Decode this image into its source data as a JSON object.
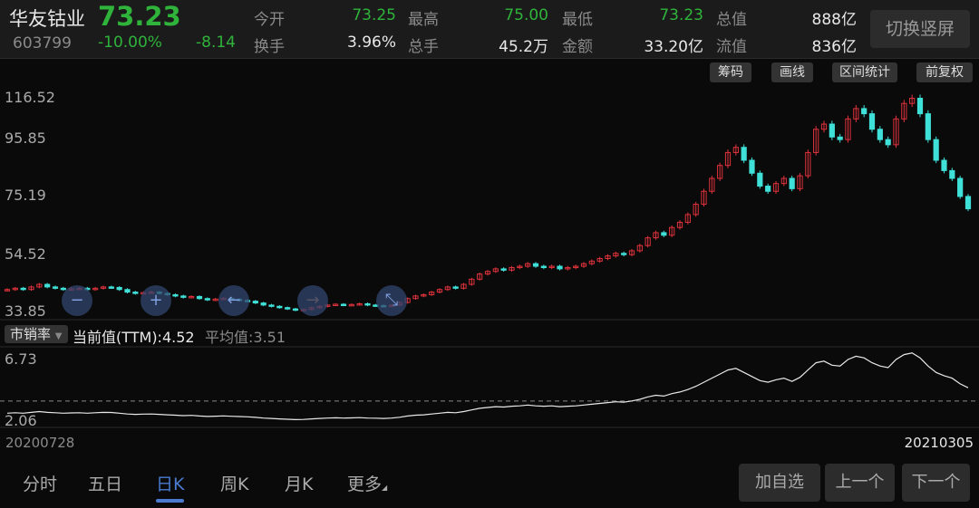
{
  "stock": {
    "name": "华友钴业",
    "code": "603799",
    "price": "73.23",
    "pct": "-10.00%",
    "change": "-8.14"
  },
  "stats": [
    {
      "label": "今开",
      "value": "73.25",
      "color": "g"
    },
    {
      "label": "最高",
      "value": "75.00",
      "color": "g"
    },
    {
      "label": "最低",
      "value": "73.23",
      "color": "g"
    },
    {
      "label": "总值",
      "value": "888亿",
      "color": "w"
    },
    {
      "label": "换手",
      "value": "3.96%",
      "color": "w"
    },
    {
      "label": "总手",
      "value": "45.2万",
      "color": "w"
    },
    {
      "label": "金额",
      "value": "33.20亿",
      "color": "w"
    },
    {
      "label": "流值",
      "value": "836亿",
      "color": "w"
    }
  ],
  "switch_label": "切换竖屏",
  "toolbar": [
    "筹码",
    "画线",
    "区间统计",
    "前复权"
  ],
  "indicator": {
    "name": "市销率",
    "current": "当前值(TTM):4.52",
    "average": "平均值:3.51"
  },
  "tabs": [
    "分时",
    "五日",
    "日K",
    "周K",
    "月K",
    "更多"
  ],
  "active_tab": 2,
  "actions": [
    "加自选",
    "上一个",
    "下一个"
  ],
  "colors": {
    "up": "#e0323c",
    "down": "#3fe0d8",
    "accent": "#4a7bd0"
  },
  "chart_data": {
    "type": "candlestick",
    "price_ticks": [
      "116.52",
      "95.85",
      "75.19",
      "54.52",
      "33.85"
    ],
    "price_range": [
      33.85,
      116.52
    ],
    "ps_ticks": [
      "6.73",
      "2.06"
    ],
    "ps_range": [
      2.06,
      6.73
    ],
    "ps_average": 3.51,
    "ps_per_price": 0.0617,
    "start_date": "20200728",
    "end_date": "20210305",
    "closes": [
      42,
      42.5,
      42,
      43,
      44,
      43,
      42.5,
      42,
      42.3,
      42.5,
      42,
      42.5,
      43,
      42.8,
      42,
      41,
      40.5,
      40.8,
      41,
      40.5,
      40,
      39.5,
      39,
      39.3,
      38.5,
      38,
      38.3,
      38.6,
      38.2,
      37.8,
      37.5,
      36.8,
      36,
      35.5,
      35,
      34.5,
      34,
      34.3,
      35,
      35.5,
      36,
      36.3,
      36,
      36.2,
      36.5,
      36,
      35.8,
      35.5,
      36,
      37,
      38.5,
      39.5,
      40,
      41,
      42,
      43,
      42.5,
      44,
      46,
      48,
      49,
      50,
      49.5,
      50.5,
      51,
      52,
      51,
      50.5,
      51,
      50,
      50.5,
      51,
      52,
      53,
      54,
      55,
      56,
      55.5,
      57,
      59,
      62,
      64,
      63,
      66,
      68,
      71,
      75,
      80,
      85,
      90,
      95,
      97,
      92,
      87,
      82,
      80,
      83,
      85,
      81,
      86,
      95,
      104,
      106,
      101,
      100,
      108,
      112,
      110,
      104,
      100,
      98,
      108,
      114,
      116,
      110,
      100,
      92,
      88,
      85,
      78,
      73.23
    ]
  }
}
